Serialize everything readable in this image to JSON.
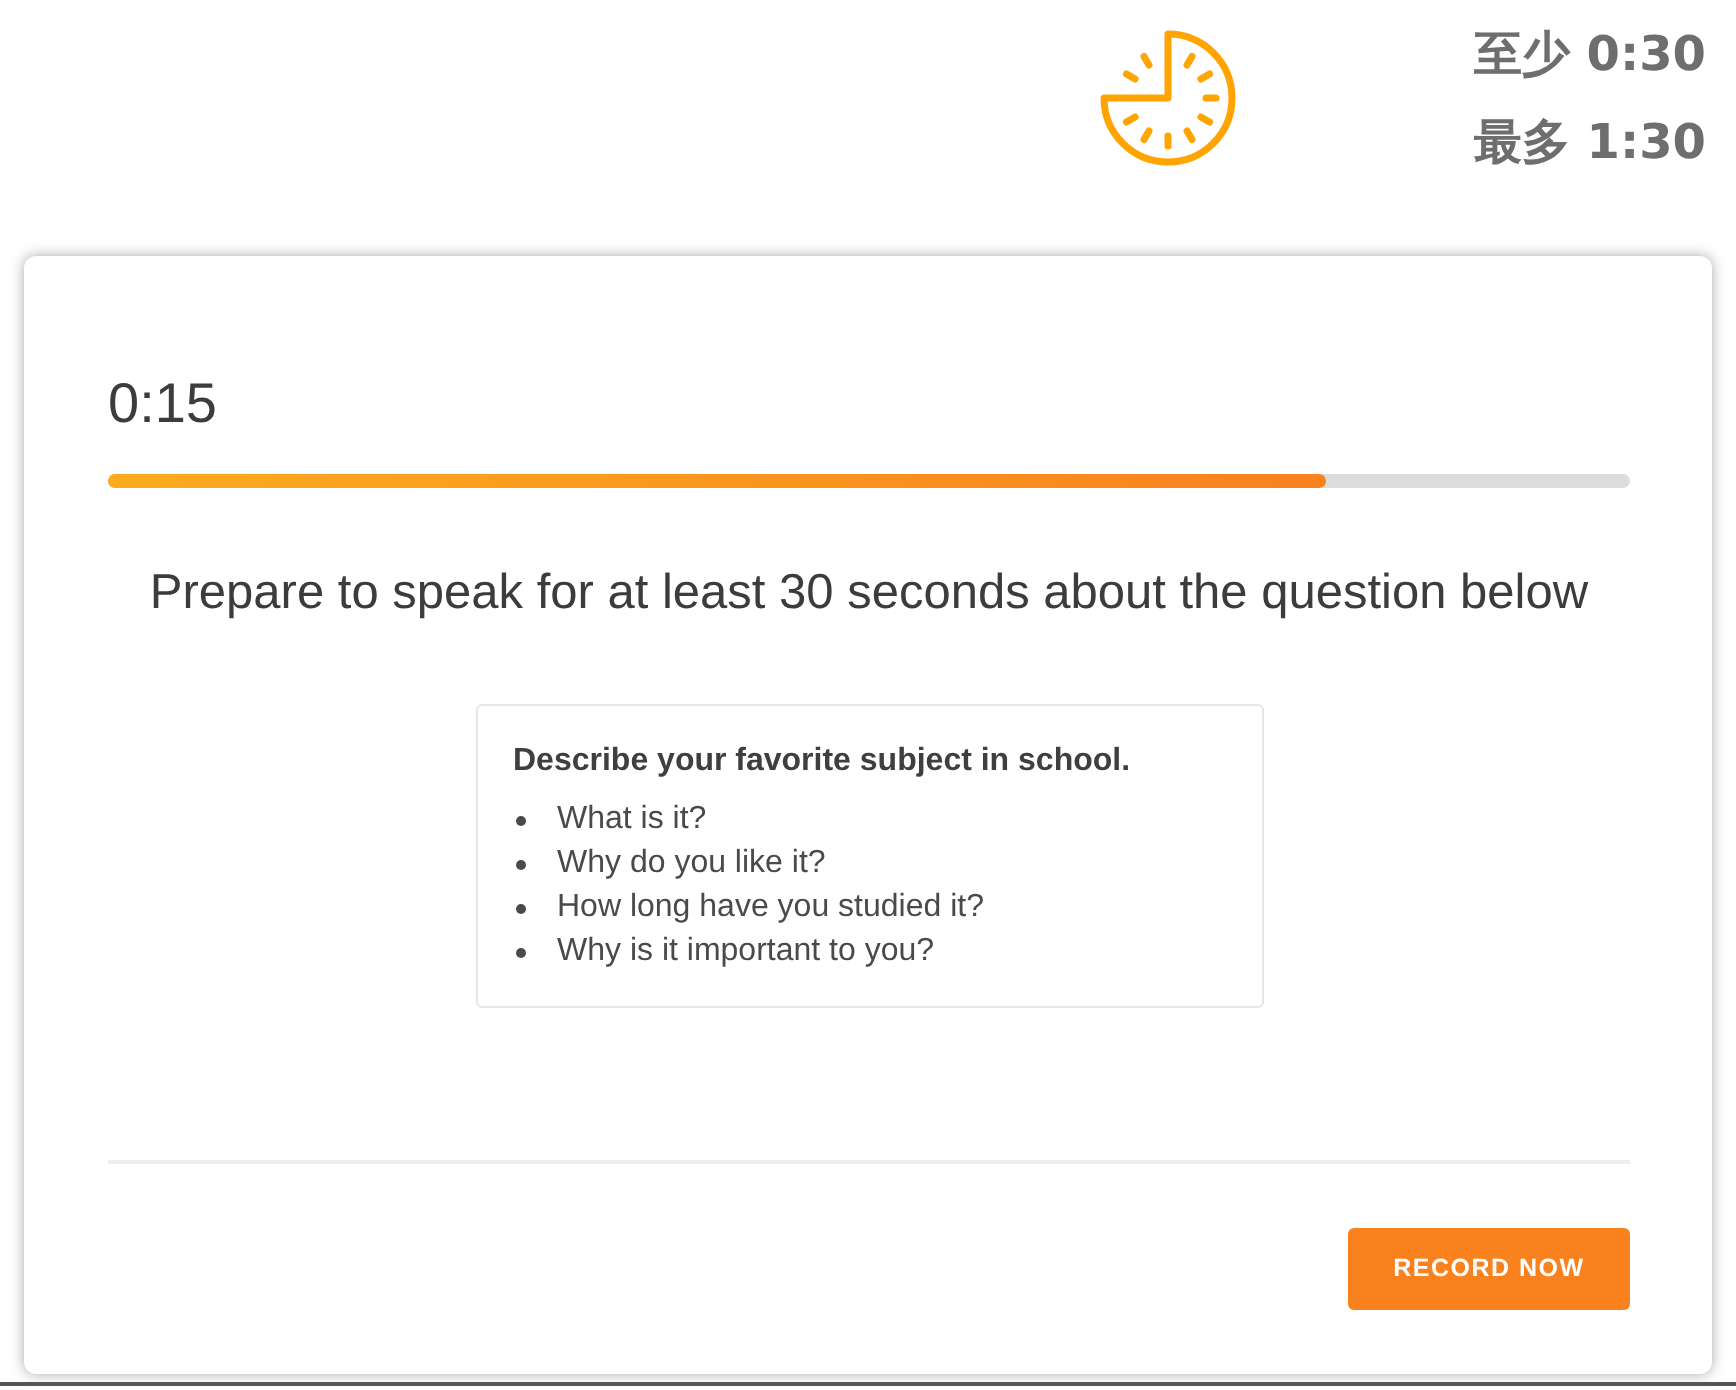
{
  "header": {
    "limits": [
      {
        "text": "至少 0:30"
      },
      {
        "text": "最多 1:30"
      }
    ]
  },
  "timer": {
    "elapsed": "0:15",
    "level": 0.8
  },
  "prompt": "Prepare to speak for at least 30 seconds about the question below",
  "question": {
    "title": "Describe your favorite subject in school.",
    "points": [
      "What is it?",
      "Why do you like it?",
      "How long have you studied it?",
      "Why is it important to you?"
    ]
  },
  "button": {
    "label": "RECORD NOW"
  }
}
